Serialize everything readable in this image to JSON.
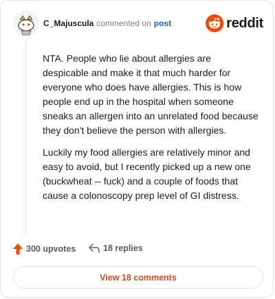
{
  "comment": {
    "author": "C_Majuscula",
    "action_text": "commented on",
    "post_link_text": "post",
    "paragraphs": [
      "NTA. People who lie about allergies are despicable and make it that much harder for everyone who does have allergies. This is how people end up in the hospital when someone sneaks an allergen into an unrelated food because they don't believe the person with allergies.",
      "Luckily my food allergies are relatively minor and easy to avoid, but I recently picked up a new one (buckwheat -- fuck) and a couple of foods that cause a colonoscopy prep level of GI distress."
    ]
  },
  "brand": {
    "name": "reddit",
    "icon": "reddit-snoo-icon",
    "color": "#ff4500"
  },
  "actions": {
    "upvotes_label": "300 upvotes",
    "upvote_icon": "upvote-arrow-icon",
    "upvote_color": "#ff4500",
    "replies_label": "18 replies",
    "reply_icon": "reply-arrow-icon"
  },
  "view_button": {
    "label": "View 18 comments",
    "color": "#d24b1f"
  }
}
